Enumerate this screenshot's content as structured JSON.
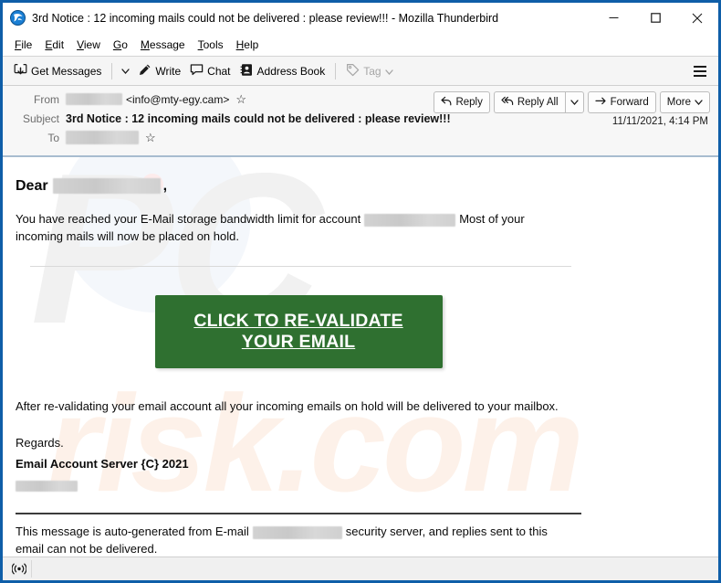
{
  "window": {
    "title": "3rd Notice : 12 incoming mails could not be delivered : please review!!! - Mozilla Thunderbird",
    "app_icon": "thunderbird-icon",
    "controls": {
      "minimize": "minimize-icon",
      "maximize": "maximize-icon",
      "close": "close-icon"
    },
    "frame_color": "#0f5ea8"
  },
  "menubar": {
    "items": [
      {
        "accel": "F",
        "rest": "ile"
      },
      {
        "accel": "E",
        "rest": "dit"
      },
      {
        "accel": "V",
        "rest": "iew"
      },
      {
        "accel": "G",
        "rest": "o"
      },
      {
        "accel": "M",
        "rest": "essage"
      },
      {
        "accel": "T",
        "rest": "ools"
      },
      {
        "accel": "H",
        "rest": "elp"
      }
    ]
  },
  "toolbar": {
    "get_messages": "Get Messages",
    "write": "Write",
    "chat": "Chat",
    "address_book": "Address Book",
    "tag": "Tag",
    "app_menu": "app-menu-icon"
  },
  "message_header": {
    "from_label": "From",
    "from_address": "<info@mty-egy.cam>",
    "subject_label": "Subject",
    "subject": "3rd Notice : 12 incoming mails could not be delivered : please review!!!",
    "to_label": "To",
    "date": "11/11/2021, 4:14 PM",
    "actions": {
      "reply": "Reply",
      "reply_all": "Reply All",
      "forward": "Forward",
      "more": "More"
    }
  },
  "body": {
    "greeting": "Dear",
    "greeting_comma": ",",
    "paragraph1_before": "You have reached your E-Mail storage bandwidth limit for account",
    "paragraph1_after": "Most of your incoming mails will now be placed on hold.",
    "cta_label": "CLICK TO RE-VALIDATE YOUR EMAIL",
    "cta_color": "#2f7030",
    "after_cta": "After re-validating your email account all your incoming emails on hold will be delivered to your mailbox.",
    "regards": "Regards.",
    "signature": "Email Account Server {C} 2021",
    "footer_before": "This message is auto-generated from E-mail",
    "footer_after": "security server, and replies sent to this email can not be delivered.",
    "watermark_big": "PC",
    "watermark_small": "risk.com"
  },
  "statusbar": {
    "connection_icon": "connection-status-icon",
    "text": ""
  }
}
